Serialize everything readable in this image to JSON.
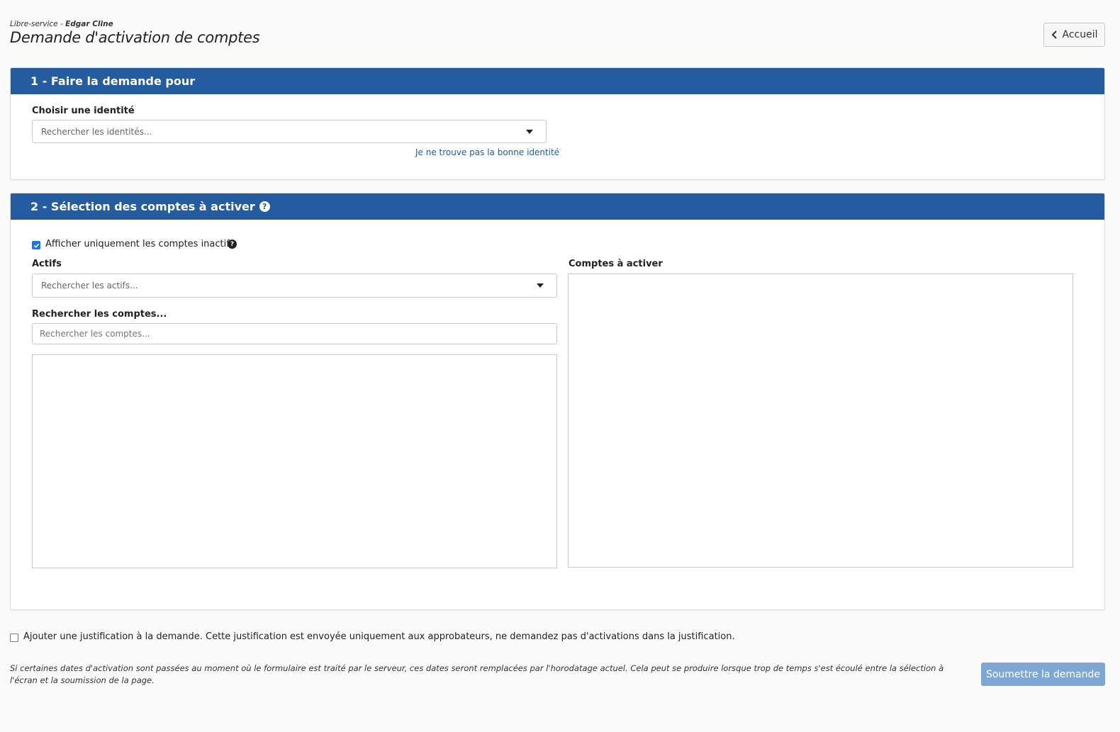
{
  "header": {
    "breadcrumb_prefix": "Libre-service - ",
    "breadcrumb_user": "Edgar Cline",
    "title": "Demande d'activation de comptes"
  },
  "home_button": {
    "label": "Accueil",
    "icon": "chevron-left-icon"
  },
  "section1": {
    "title": "1 - Faire la demande pour",
    "identity_label": "Choisir une identité",
    "identity_placeholder": "Rechercher les identités...",
    "not_found_link": "Je ne trouve pas la bonne identité"
  },
  "section2": {
    "title": "2 - Sélection des comptes à activer",
    "only_inactive_label": "Afficher uniquement les comptes inactifs",
    "only_inactive_checked": true,
    "assets_label": "Actifs",
    "assets_placeholder": "Rechercher les actifs...",
    "search_accounts_label": "Rechercher les comptes...",
    "search_accounts_placeholder": "Rechercher les comptes...",
    "accounts_to_activate_label": "Comptes à activer"
  },
  "justification": {
    "checked": false,
    "label": "Ajouter une justification à la demande. Cette justification est envoyée uniquement aux approbateurs, ne demandez pas d'activations dans la justification."
  },
  "footnote": "Si certaines dates d'activation sont passées au moment où le formulaire est traité par le serveur, ces dates seront remplacées par l'horodatage actuel. Cela peut se produire lorsque trop de temps s'est écoulé entre la sélection à l'écran et la soumission de la page.",
  "submit_button": {
    "label": "Soumettre la demande"
  },
  "colors": {
    "panel_header": "#245c9f",
    "link": "#245c9f",
    "submit_disabled": "#7ea7d4",
    "checkbox": "#1a73e8"
  }
}
